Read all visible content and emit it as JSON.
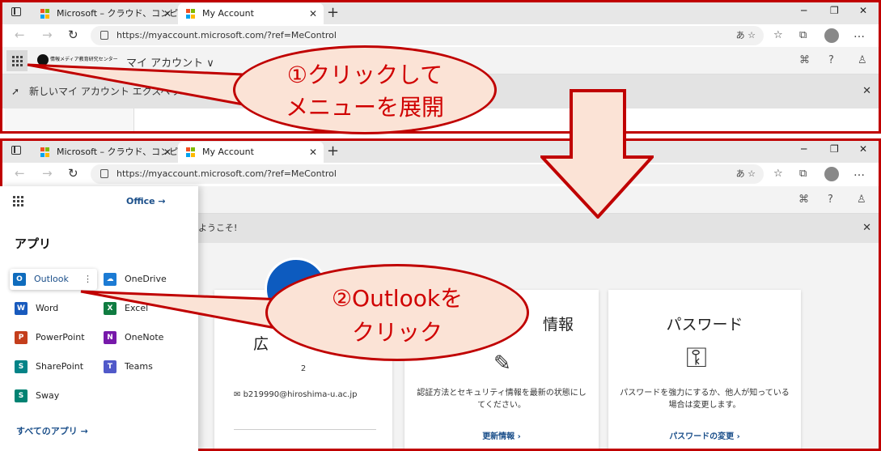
{
  "browser": {
    "tabs": [
      {
        "label": "Microsoft – クラウド、コンピューター、",
        "close": "✕"
      },
      {
        "label": "My Account",
        "close": "✕"
      }
    ],
    "new_tab": "+",
    "window_controls": [
      "─",
      "❐",
      "✕"
    ],
    "url": "https://myaccount.microsoft.com/?ref=MeControl",
    "nav": {
      "back": "←",
      "forward": "→",
      "reload": "↻"
    },
    "url_icons": "あ ☆",
    "more": "…"
  },
  "screen1": {
    "logo_text": "情報メディア教育研究センター",
    "account_title": "マイ アカウント ∨",
    "header_icons": [
      "⌘",
      "?",
      "♙"
    ],
    "banner_text": "新しいマイ アカウント エクスペリエンスへようこそ",
    "banner_close": "✕"
  },
  "screen2": {
    "office_link": "Office →",
    "apps_heading": "アプリ",
    "apps": [
      {
        "name": "Outlook",
        "icon": "outlook-icon",
        "color": "#0f6cbd",
        "glyph": "O"
      },
      {
        "name": "OneDrive",
        "icon": "onedrive-icon",
        "color": "#1c7bd4",
        "glyph": "☁"
      },
      {
        "name": "Word",
        "icon": "word-icon",
        "color": "#185abd",
        "glyph": "W"
      },
      {
        "name": "Excel",
        "icon": "excel-icon",
        "color": "#107c41",
        "glyph": "X"
      },
      {
        "name": "PowerPoint",
        "icon": "powerpoint-icon",
        "color": "#c43e1c",
        "glyph": "P"
      },
      {
        "name": "OneNote",
        "icon": "onenote-icon",
        "color": "#7719aa",
        "glyph": "N"
      },
      {
        "name": "SharePoint",
        "icon": "sharepoint-icon",
        "color": "#038387",
        "glyph": "S"
      },
      {
        "name": "Teams",
        "icon": "teams-icon",
        "color": "#5059c9",
        "glyph": "T"
      },
      {
        "name": "Sway",
        "icon": "sway-icon",
        "color": "#008272",
        "glyph": "S"
      }
    ],
    "more_dots": "⋮",
    "all_apps": "すべてのアプリ →",
    "banner_text": "ようこそ!",
    "banner_close": "✕",
    "profile_name": "広",
    "profile_number": "2",
    "profile_email": "b219990@hiroshima-u.ac.jp",
    "security_title": "情報",
    "security_desc": "認証方法とセキュリティ情報を最新の状態にしてください。",
    "security_link": "更新情報 ›",
    "password_title": "パスワード",
    "password_desc": "パスワードを強力にするか、他人が知っている場合は変更します。",
    "password_link": "パスワードの変更 ›",
    "key_icon": "⚿"
  },
  "annotations": {
    "bubble1_line1": "①クリックして",
    "bubble1_line2": "メニューを展開",
    "bubble2_line1": "②Outlookを",
    "bubble2_line2": "クリック",
    "color": "#c00000",
    "fill": "#fbe3d6"
  }
}
